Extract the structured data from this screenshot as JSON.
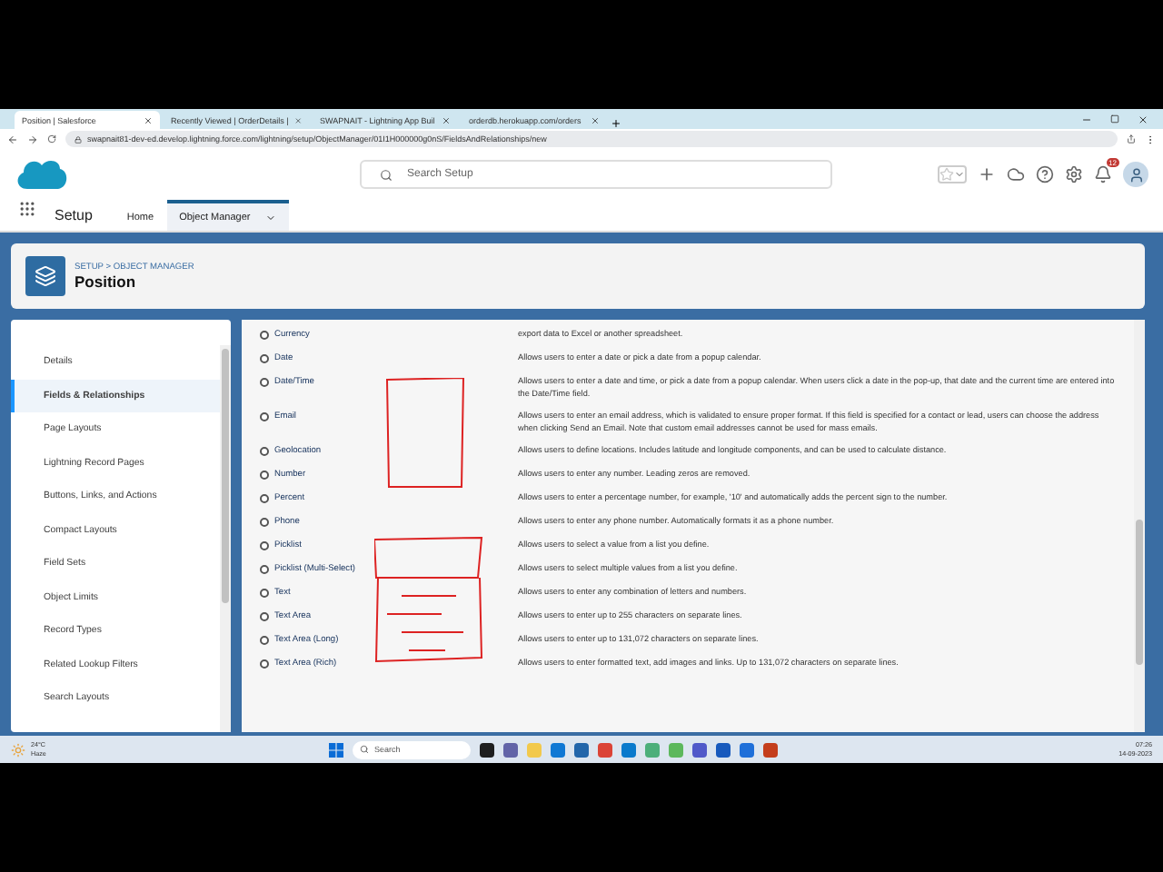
{
  "browser": {
    "tabs": [
      {
        "title": "Position | Salesforce",
        "selected": true
      },
      {
        "title": "Recently Viewed | OrderDetails |",
        "selected": false
      },
      {
        "title": "SWAPNAIT - Lightning App Buil",
        "selected": false
      },
      {
        "title": "orderdb.herokuapp.com/orders",
        "selected": false
      }
    ],
    "url": "swapnait81-dev-ed.develop.lightning.force.com/lightning/setup/ObjectManager/01I1H000000g0nS/FieldsAndRelationships/new"
  },
  "header": {
    "search": {
      "placeholder": "Search Setup"
    },
    "notification_count": "12"
  },
  "nav": {
    "app": "Setup",
    "items": [
      {
        "label": "Home",
        "selected": false
      },
      {
        "label": "Object Manager",
        "selected": true
      }
    ]
  },
  "object_header": {
    "breadcrumb": "SETUP > OBJECT MANAGER",
    "title": "Position"
  },
  "sidebar": {
    "items": [
      {
        "label": "Details",
        "selected": false
      },
      {
        "label": "Fields & Relationships",
        "selected": true
      },
      {
        "label": "Page Layouts",
        "selected": false
      },
      {
        "label": "Lightning Record Pages",
        "selected": false
      },
      {
        "label": "Buttons, Links, and Actions",
        "selected": false
      },
      {
        "label": "Compact Layouts",
        "selected": false
      },
      {
        "label": "Field Sets",
        "selected": false
      },
      {
        "label": "Object Limits",
        "selected": false
      },
      {
        "label": "Record Types",
        "selected": false
      },
      {
        "label": "Related Lookup Filters",
        "selected": false
      },
      {
        "label": "Search Layouts",
        "selected": false
      }
    ]
  },
  "field_types": [
    {
      "label": "Currency",
      "description": "export data to Excel or another spreadsheet.",
      "selected": false
    },
    {
      "label": "Date",
      "description": "Allows users to enter a date or pick a date from a popup calendar.",
      "selected": false
    },
    {
      "label": "Date/Time",
      "description": "Allows users to enter a date and time, or pick a date from a popup calendar. When users click a date in the pop-up, that date and the current time are entered into the Date/Time field.",
      "selected": false
    },
    {
      "label": "Email",
      "description": "Allows users to enter an email address, which is validated to ensure proper format. If this field is specified for a contact or lead, users can choose the address when clicking Send an Email. Note that custom email addresses cannot be used for mass emails.",
      "selected": false
    },
    {
      "label": "Geolocation",
      "description": "Allows users to define locations. Includes latitude and longitude components, and can be used to calculate distance.",
      "selected": false
    },
    {
      "label": "Number",
      "description": "Allows users to enter any number. Leading zeros are removed.",
      "selected": false
    },
    {
      "label": "Percent",
      "description": "Allows users to enter a percentage number, for example, '10' and automatically adds the percent sign to the number.",
      "selected": false
    },
    {
      "label": "Phone",
      "description": "Allows users to enter any phone number. Automatically formats it as a phone number.",
      "selected": false
    },
    {
      "label": "Picklist",
      "description": "Allows users to select a value from a list you define.",
      "selected": false
    },
    {
      "label": "Picklist (Multi-Select)",
      "description": "Allows users to select multiple values from a list you define.",
      "selected": false
    },
    {
      "label": "Text",
      "description": "Allows users to enter any combination of letters and numbers.",
      "selected": false
    },
    {
      "label": "Text Area",
      "description": "Allows users to enter up to 255 characters on separate lines.",
      "selected": false
    },
    {
      "label": "Text Area (Long)",
      "description": "Allows users to enter up to 131,072 characters on separate lines.",
      "selected": false
    },
    {
      "label": "Text Area (Rich)",
      "description": "Allows users to enter formatted text, add images and links. Up to 131,072 characters on separate lines.",
      "selected": false
    }
  ],
  "taskbar": {
    "temperature": "24°C",
    "weather": "Haze",
    "search": {
      "placeholder": "Search"
    },
    "time": "07:26",
    "date": "14-09-2023"
  }
}
